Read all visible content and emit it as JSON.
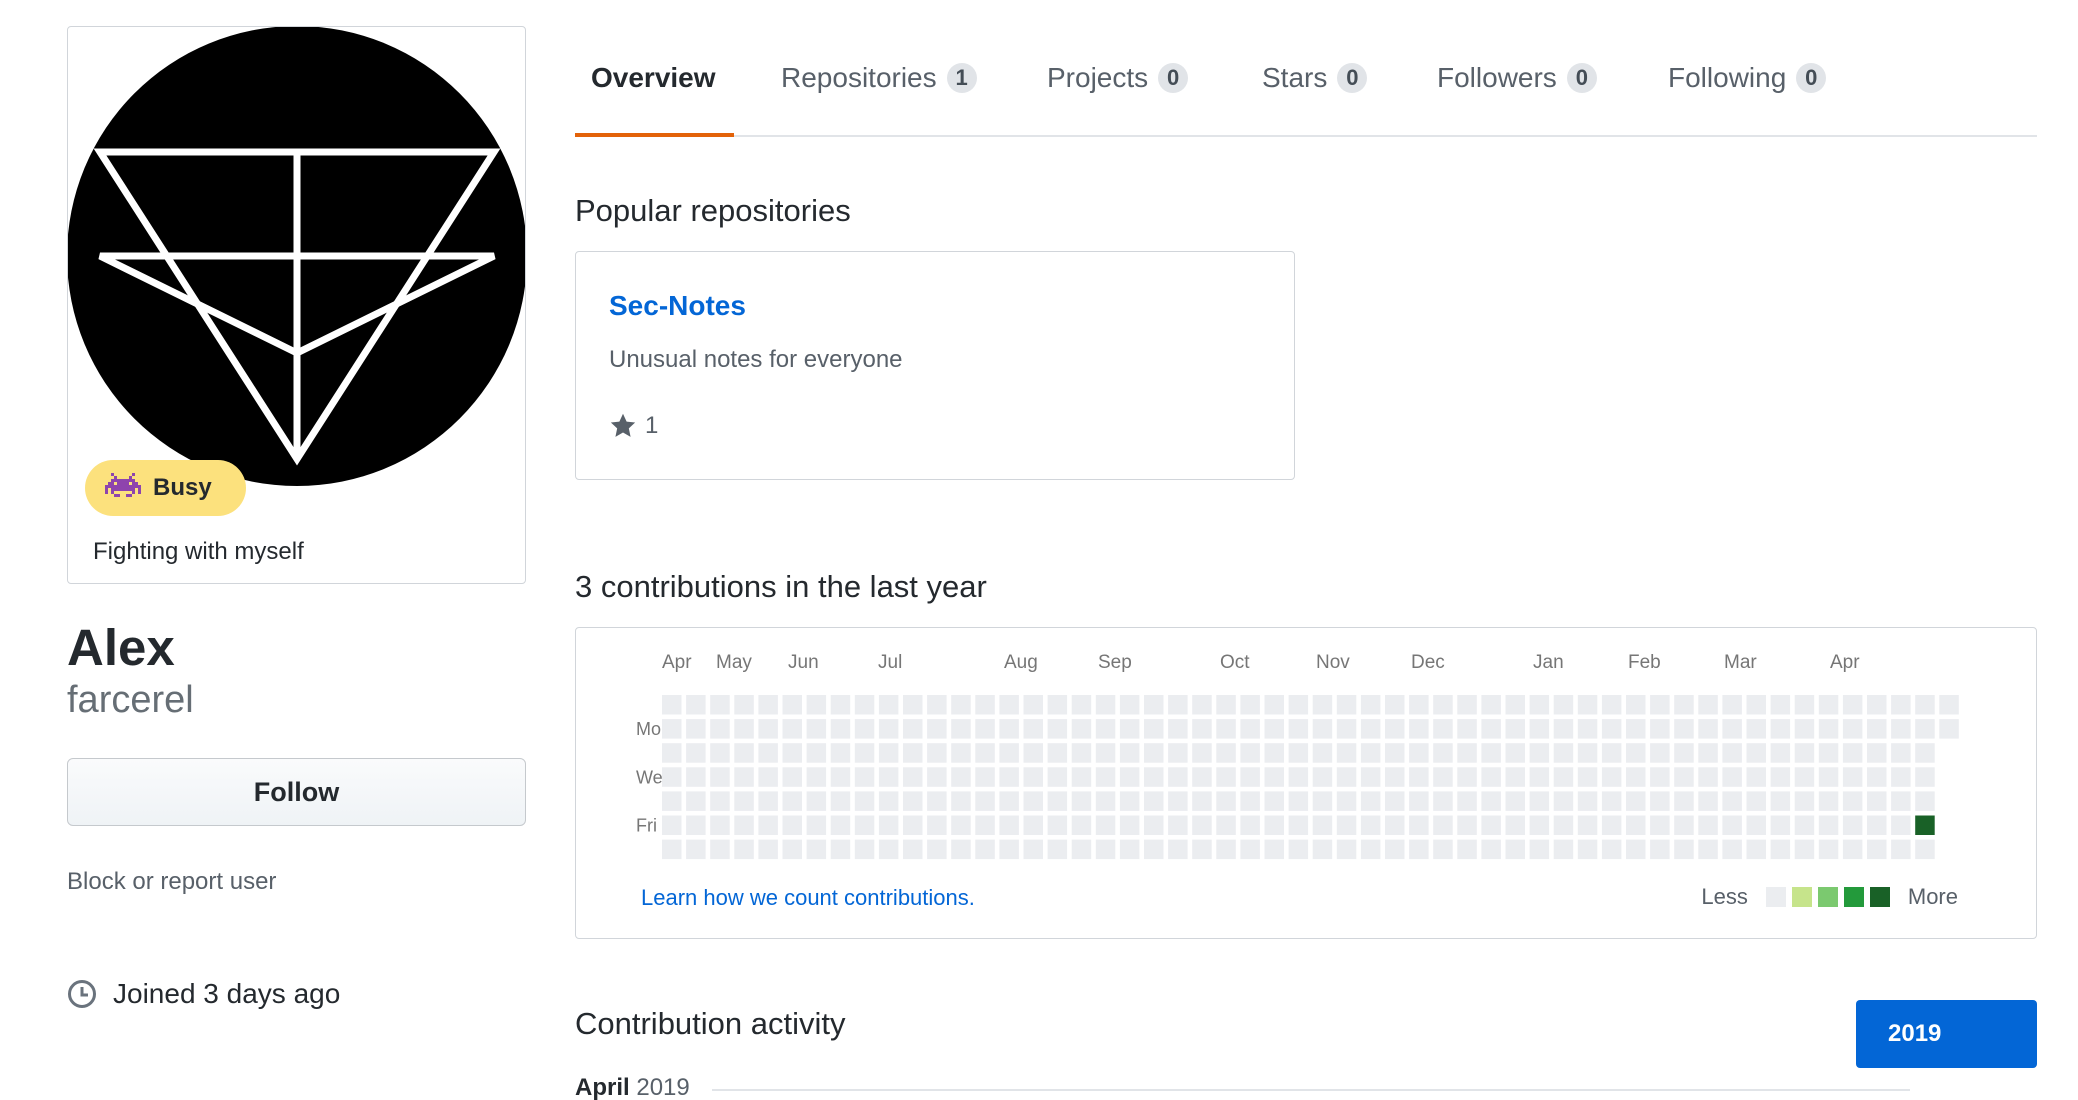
{
  "profile": {
    "status": {
      "emoji_icon": "space-invader-icon",
      "label": "Busy",
      "message": "Fighting with myself",
      "color": "#fce17d"
    },
    "name": "Alex",
    "login": "farcerel",
    "follow_label": "Follow",
    "block_label": "Block or report user",
    "joined": "Joined 3 days ago"
  },
  "tabs": [
    {
      "label": "Overview",
      "count": null,
      "selected": true
    },
    {
      "label": "Repositories",
      "count": "1"
    },
    {
      "label": "Projects",
      "count": "0"
    },
    {
      "label": "Stars",
      "count": "0"
    },
    {
      "label": "Followers",
      "count": "0"
    },
    {
      "label": "Following",
      "count": "0"
    }
  ],
  "popular": {
    "title": "Popular repositories",
    "repos": [
      {
        "name": "Sec-Notes",
        "description": "Unusual notes for everyone",
        "stars": "1"
      }
    ]
  },
  "contributions": {
    "title": "3 contributions in the last year",
    "months": [
      "Apr",
      "May",
      "Jun",
      "Jul",
      "Aug",
      "Sep",
      "Oct",
      "Nov",
      "Dec",
      "Jan",
      "Feb",
      "Mar",
      "Apr"
    ],
    "days": [
      "Mon",
      "Wed",
      "Fri"
    ],
    "weeks": 54,
    "last_week_days": 2,
    "active_cell": {
      "week": 52,
      "day": 5,
      "level": 4
    },
    "learn_link": "Learn how we count contributions.",
    "legend_less": "Less",
    "legend_more": "More",
    "colors": [
      "#ebedf0",
      "#c6e48b",
      "#7bc96f",
      "#239a3b",
      "#196127"
    ]
  },
  "activity": {
    "title": "Contribution activity",
    "year_button": "2019",
    "month": "April",
    "year": "2019"
  },
  "accent": {
    "tab_underline": "#e36209",
    "link": "#0366d6"
  }
}
